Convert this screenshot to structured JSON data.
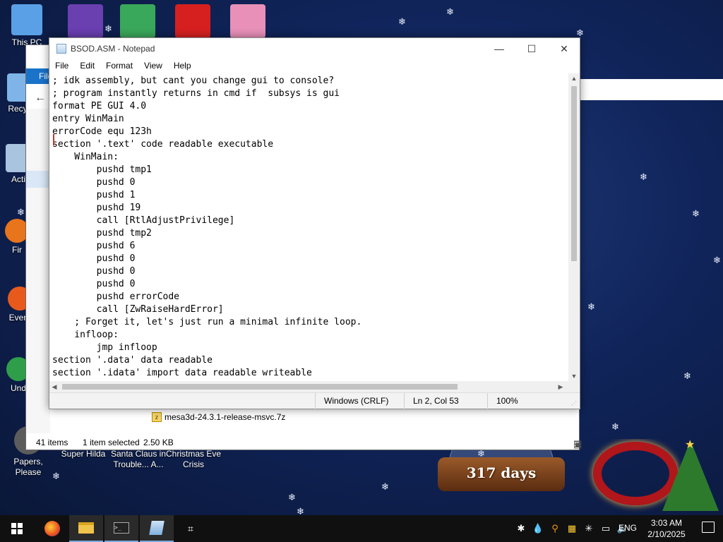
{
  "desktop": {
    "icons": [
      {
        "label": "This PC",
        "color": "#5aa0e6"
      },
      {
        "label": "Recyc",
        "color": "#7fb4e8"
      },
      {
        "label": "Acti",
        "color": "#a8c4de"
      },
      {
        "label": "Fir",
        "color": "#e8741c"
      },
      {
        "label": "Every",
        "color": "#e85a1c"
      },
      {
        "label": "Und",
        "color": "#2e9e4a"
      },
      {
        "label": "Papers, Please",
        "color": "#5c5c5c"
      },
      {
        "label": "Super Hilda",
        "color": "#6b8fd6"
      },
      {
        "label": "Santa Claus in Trouble... A...",
        "color": "#c73a3a"
      },
      {
        "label": "Christmas Eve Crisis",
        "color": "#4a6ea8"
      }
    ],
    "top_icons": [
      {
        "color": "#2f6fd0"
      },
      {
        "color": "#6a3fb0"
      },
      {
        "color": "#3aa85a"
      },
      {
        "color": "#d62020"
      },
      {
        "color": "#e890b8"
      }
    ],
    "countdown": "317 days"
  },
  "explorer": {
    "ribbon_label": "File",
    "file_name": "mesa3d-24.3.1-release-msvc.7z",
    "status_items": "41 items",
    "status_selected": "1 item selected",
    "status_size": "2.50 KB"
  },
  "notepad": {
    "title": "BSOD.ASM - Notepad",
    "menu": [
      "File",
      "Edit",
      "Format",
      "View",
      "Help"
    ],
    "content": "; idk assembly, but cant you change gui to console?\n; program instantly returns in cmd if  subsys is gui\nformat PE GUI 4.0\nentry WinMain\nerrorCode equ 123h\nsection '.text' code readable executable\n    WinMain:\n        pushd tmp1\n        pushd 0\n        pushd 1\n        pushd 19\n        call [RtlAdjustPrivilege]\n        pushd tmp2\n        pushd 6\n        pushd 0\n        pushd 0\n        pushd 0\n        pushd errorCode\n        call [ZwRaiseHardError]\n    ; Forget it, let's just run a minimal infinite loop.\n    infloop:\n        jmp infloop\nsection '.data' data readable\nsection '.idata' import data readable writeable",
    "status": {
      "line_ending": "Windows (CRLF)",
      "position": "Ln 2, Col 53",
      "zoom": "100%"
    }
  },
  "taskbar": {
    "language": "ENG",
    "time": "3:03 AM",
    "date": "2/10/2025"
  }
}
